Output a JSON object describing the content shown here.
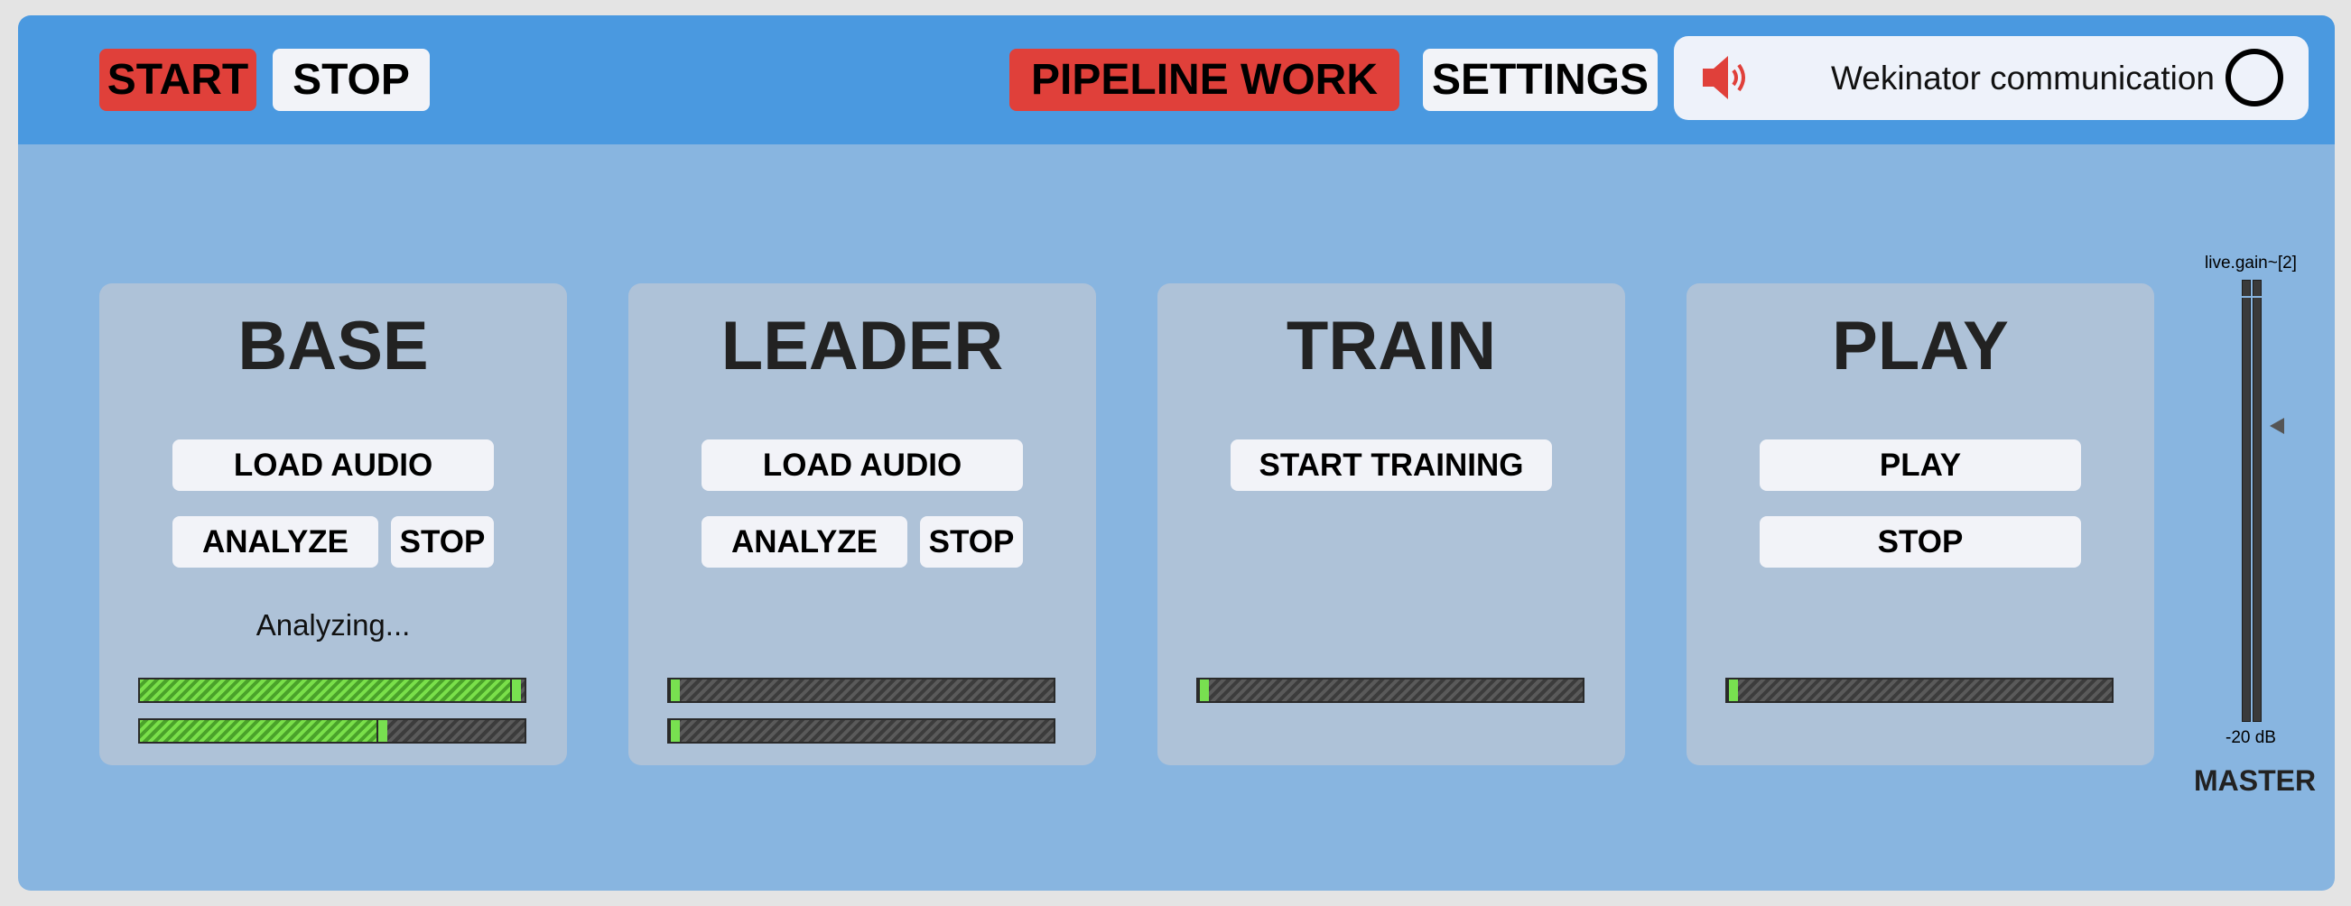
{
  "toolbar": {
    "start_label": "START",
    "stop_label": "STOP",
    "pipeline_label": "PIPELINE WORK",
    "settings_label": "SETTINGS",
    "speaker_icon": "speaker-icon",
    "wekinator_label": "Wekinator communication",
    "wekinator_status_icon": "circle-status-icon"
  },
  "panels": {
    "base": {
      "title": "BASE",
      "load_label": "LOAD AUDIO",
      "analyze_label": "ANALYZE",
      "stop_label": "STOP",
      "status": "Analyzing...",
      "progress": [
        1.0,
        0.65
      ]
    },
    "leader": {
      "title": "LEADER",
      "load_label": "LOAD AUDIO",
      "analyze_label": "ANALYZE",
      "stop_label": "STOP",
      "progress": [
        0.0,
        0.0
      ]
    },
    "train": {
      "title": "TRAIN",
      "start_training_label": "START TRAINING",
      "progress": [
        0.0
      ]
    },
    "play": {
      "title": "PLAY",
      "play_label": "PLAY",
      "stop_label": "STOP",
      "progress": [
        0.0
      ]
    }
  },
  "master": {
    "gain_object_name": "live.gain~[2]",
    "db_label": "-20 dB",
    "label": "MASTER",
    "gain_level": 0.67
  },
  "colors": {
    "accent_red": "#e0403a",
    "header_blue": "#4a99e0",
    "panel_bg": "#aec2d8",
    "meter_green": "#7ae04a"
  }
}
